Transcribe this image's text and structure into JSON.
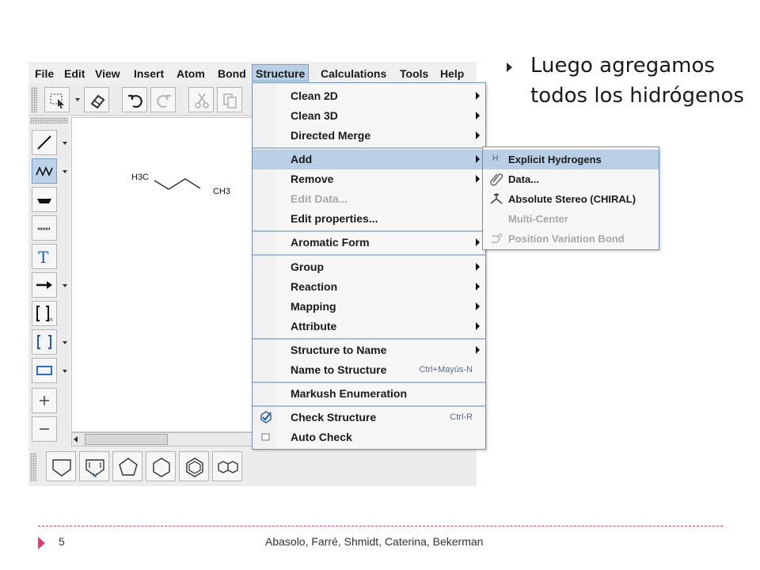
{
  "slide": {
    "bullet": "Luego agregamos todos los hidrógenos",
    "page_number": "5",
    "authors": "Abasolo, Farré, Shmidt, Caterina, Bekerman"
  },
  "menubar": [
    "File",
    "Edit",
    "View",
    "Insert",
    "Atom",
    "Bond",
    "Structure",
    "Calculations",
    "Tools",
    "Help"
  ],
  "active_menu": "Structure",
  "molecule": {
    "left_label": "H3C",
    "right_label": "CH3"
  },
  "structure_menu": {
    "items": [
      {
        "label": "Clean 2D",
        "submenu": true
      },
      {
        "label": "Clean 3D",
        "submenu": true
      },
      {
        "label": "Directed Merge",
        "submenu": true
      },
      {
        "label": "Add",
        "submenu": true,
        "highlighted": true
      },
      {
        "label": "Remove",
        "submenu": true
      },
      {
        "label": "Edit Data...",
        "disabled": true
      },
      {
        "label": "Edit properties..."
      },
      {
        "label": "Aromatic Form",
        "submenu": true
      },
      {
        "label": "Group",
        "submenu": true
      },
      {
        "label": "Reaction",
        "submenu": true
      },
      {
        "label": "Mapping",
        "submenu": true
      },
      {
        "label": "Attribute",
        "submenu": true
      },
      {
        "label": "Structure to Name",
        "submenu": true
      },
      {
        "label": "Name to Structure",
        "shortcut": "Ctrl+Mayús-N"
      },
      {
        "label": "Markush Enumeration"
      },
      {
        "label": "Check Structure",
        "shortcut": "Ctrl-R",
        "icon": "check-structure-icon"
      },
      {
        "label": "Auto Check",
        "icon": "checkbox-icon"
      }
    ]
  },
  "add_submenu": {
    "items": [
      {
        "label": "Explicit Hydrogens",
        "icon": "H",
        "highlighted": true
      },
      {
        "label": "Data...",
        "icon": "paperclip-icon"
      },
      {
        "label": "Absolute Stereo (CHIRAL)",
        "icon": "stereo-icon"
      },
      {
        "label": "Multi-Center",
        "disabled": true
      },
      {
        "label": "Position Variation Bond",
        "icon": "position-variation-icon",
        "disabled": true
      }
    ]
  },
  "colors": {
    "menu_highlight": "#b8cfe5",
    "menu_border": "#6f8fb8",
    "footer_accent": "#d9407c",
    "tool_blue": "#1a5fb4"
  }
}
